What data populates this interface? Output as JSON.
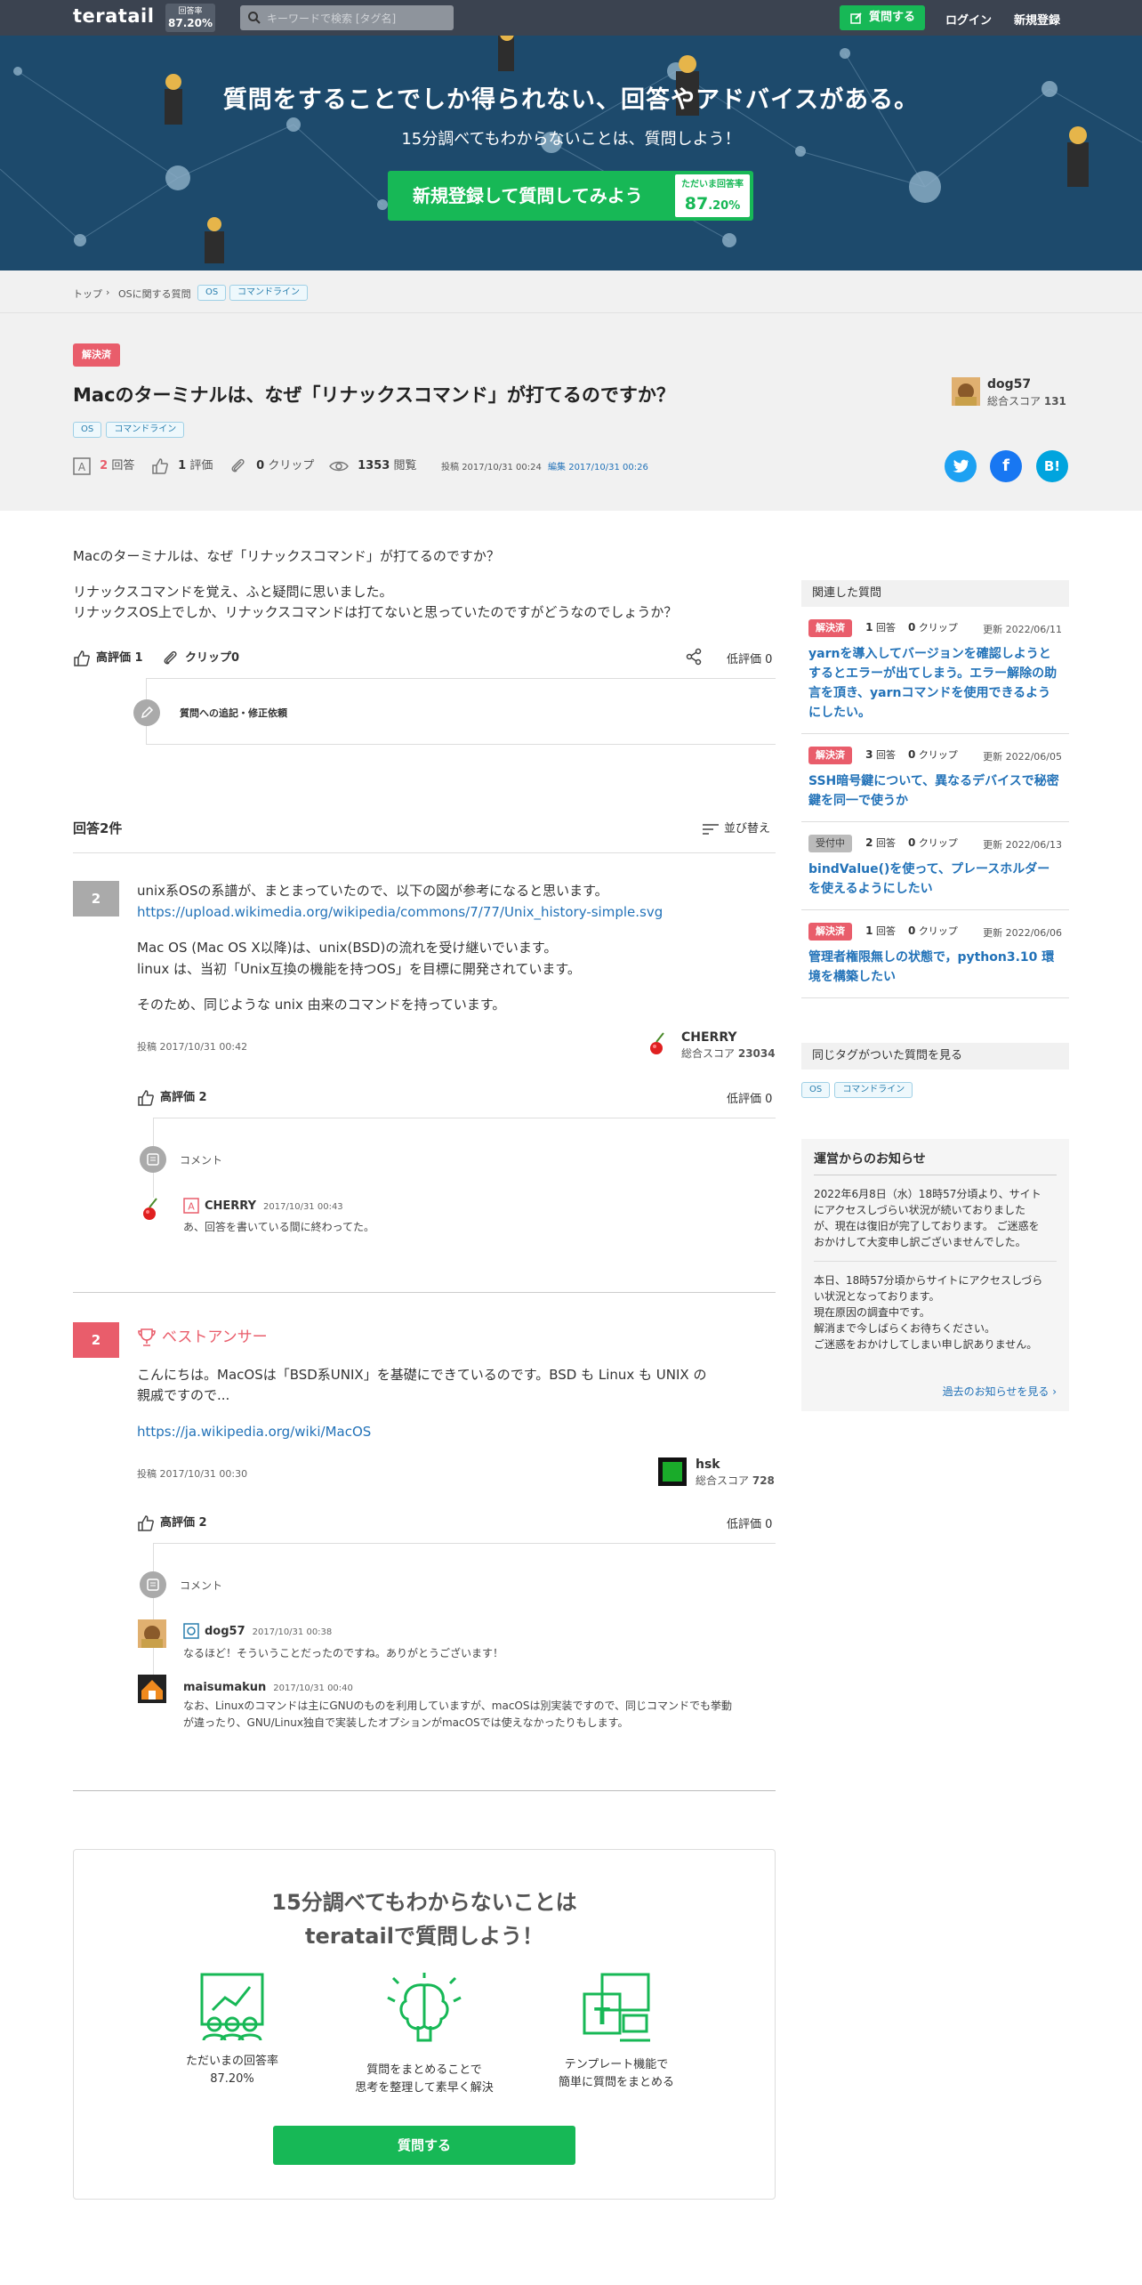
{
  "header": {
    "logo": "teratail",
    "rate_label": "回答率",
    "rate_value": "87.20%",
    "search_placeholder": "キーワードで検索 [タグ名]",
    "ask_button": "質問する",
    "login": "ログイン",
    "signup": "新規登録"
  },
  "hero": {
    "title": "質問をすることでしか得られない、回答やアドバイスがある。",
    "subtitle": "15分調べてもわからないことは、質問しよう！",
    "cta": "新規登録して質問してみよう",
    "rate_label": "ただいま回答率",
    "rate_big": "87",
    "rate_small": ".20%"
  },
  "breadcrumb": {
    "top": "トップ",
    "category": "OSに関する質問",
    "tags": [
      "OS",
      "コマンドライン"
    ]
  },
  "question": {
    "status": "解決済",
    "title": "Macのターミナルは、なぜ「リナックスコマンド」が打てるのですか？",
    "tags": [
      "OS",
      "コマンドライン"
    ],
    "answers_count": "2",
    "answers_label": "回答",
    "rating_count": "1",
    "rating_label": "評価",
    "clips_count": "0",
    "clips_label": "クリップ",
    "views_count": "1353",
    "views_label": "閲覧",
    "posted_label": "投稿",
    "posted": "2017/10/31 00:24",
    "edited_label": "編集",
    "edited": "2017/10/31 00:26",
    "author": {
      "name": "dog57",
      "score_label": "総合スコア",
      "score": "131"
    },
    "body": [
      "Macのターミナルは、なぜ「リナックスコマンド」が打てるのですか？",
      "リナックスコマンドを覚え、ふと疑問に思いました。",
      "リナックスOS上でしか、リナックスコマンドは打てないと思っていたのですがどうなのでしょうか？"
    ],
    "upvote": "高評価 1",
    "clip": "クリップ0",
    "downvote": "低評価 0",
    "edit_request": "質問への追記・修正依頼"
  },
  "answers_section": {
    "title": "回答2件",
    "sort": "並び替え"
  },
  "answer1": {
    "score": "2",
    "lines": [
      "unix系OSの系譜が、まとまっていたので、以下の図が参考になると思います。",
      "https://upload.wikimedia.org/wikipedia/commons/7/77/Unix_history-simple.svg",
      "Mac OS (Mac OS X以降)は、unix(BSD)の流れを受け継いでいます。",
      "linux は、当初「Unix互換の機能を持つOS」を目標に開発されています。",
      "そのため、同じような unix 由来のコマンドを持っています。"
    ],
    "posted": "投稿 2017/10/31 00:42",
    "author": "CHERRY",
    "score_label": "総合スコア",
    "author_score": "23034",
    "upvote": "高評価 2",
    "downvote": "低評価 0",
    "comment_label": "コメント",
    "comments": [
      {
        "name": "CHERRY",
        "time": "2017/10/31 00:43",
        "text": "あ、回答を書いている間に終わってた。"
      }
    ]
  },
  "answer2": {
    "score": "2",
    "best": "ベストアンサー",
    "lines": [
      "こんにちは。MacOSは「BSD系UNIX」を基礎にできているのです。BSD も Linux も UNIX の",
      "親戚ですので...",
      "https://ja.wikipedia.org/wiki/MacOS"
    ],
    "posted": "投稿 2017/10/31 00:30",
    "author": "hsk",
    "score_label": "総合スコア",
    "author_score": "728",
    "upvote": "高評価 2",
    "downvote": "低評価 0",
    "comment_label": "コメント",
    "comments": [
      {
        "name": "dog57",
        "time": "2017/10/31 00:38",
        "text": "なるほど！そういうことだったのですね。ありがとうございます！"
      },
      {
        "name": "maisumakun",
        "time": "2017/10/31 00:40",
        "text": "なお、Linuxのコマンドは主にGNUのものを利用していますが、macOSは別実装ですので、同じコマンドでも挙動",
        "text2": "が違ったり、GNU/Linux独自で実装したオプションがmacOSでは使えなかったりもします。"
      }
    ]
  },
  "sidebar": {
    "related_title": "関連した質問",
    "related": [
      {
        "status": "解決済",
        "color": "#e95d6b",
        "answers": "1",
        "answers_label": "回答",
        "clips": "0",
        "clips_label": "クリップ",
        "updated": "更新 2022/06/11",
        "title": "yarnを導入してバージョンを確認しようとするとエラーが出てしまう。エラー解除の助言を頂き、yarnコマンドを使用できるようにしたい。"
      },
      {
        "status": "解決済",
        "color": "#e95d6b",
        "answers": "3",
        "answers_label": "回答",
        "clips": "0",
        "clips_label": "クリップ",
        "updated": "更新 2022/06/05",
        "title": "SSH暗号鍵について、異なるデバイスで秘密鍵を同一で使うか"
      },
      {
        "status": "受付中",
        "color": "#bbbbbb",
        "answers": "2",
        "answers_label": "回答",
        "clips": "0",
        "clips_label": "クリップ",
        "updated": "更新 2022/06/13",
        "title": "bindValue()を使って、プレースホルダーを使えるようにしたい"
      },
      {
        "status": "解決済",
        "color": "#e95d6b",
        "answers": "1",
        "answers_label": "回答",
        "clips": "0",
        "clips_label": "クリップ",
        "updated": "更新 2022/06/06",
        "title": "管理者権限無しの状態で，python3.10 環境を構築したい"
      }
    ],
    "same_tag_title": "同じタグがついた質問を見る",
    "same_tags": [
      "OS",
      "コマンドライン"
    ],
    "notice_title": "運営からのお知らせ",
    "notice1": [
      "2022年6月8日（水）18時57分頃より、サイト",
      "にアクセスしづらい状況が続いておりました",
      "が、現在は復旧が完了しております。 ご迷惑を",
      "おかけして大変申し訳ございませんでした。"
    ],
    "notice2": [
      "本日、18時57分頃からサイトにアクセスしづら",
      "い状況となっております。",
      "現在原因の調査中です。",
      "解消まで今しばらくお待ちください。",
      "ご迷惑をおかけしてしまい申し訳ありません。"
    ],
    "notice_more": "過去のお知らせを見る ›"
  },
  "cta": {
    "title1": "15分調べてもわからないことは",
    "title2": "teratailで質問しよう！",
    "f1a": "ただいまの回答率",
    "f1b": "87.20%",
    "f2a": "質問をまとめることで",
    "f2b": "思考を整理して素早く解決",
    "f3a": "テンプレート機能で",
    "f3b": "簡単に質問をまとめる",
    "button": "質問する"
  }
}
